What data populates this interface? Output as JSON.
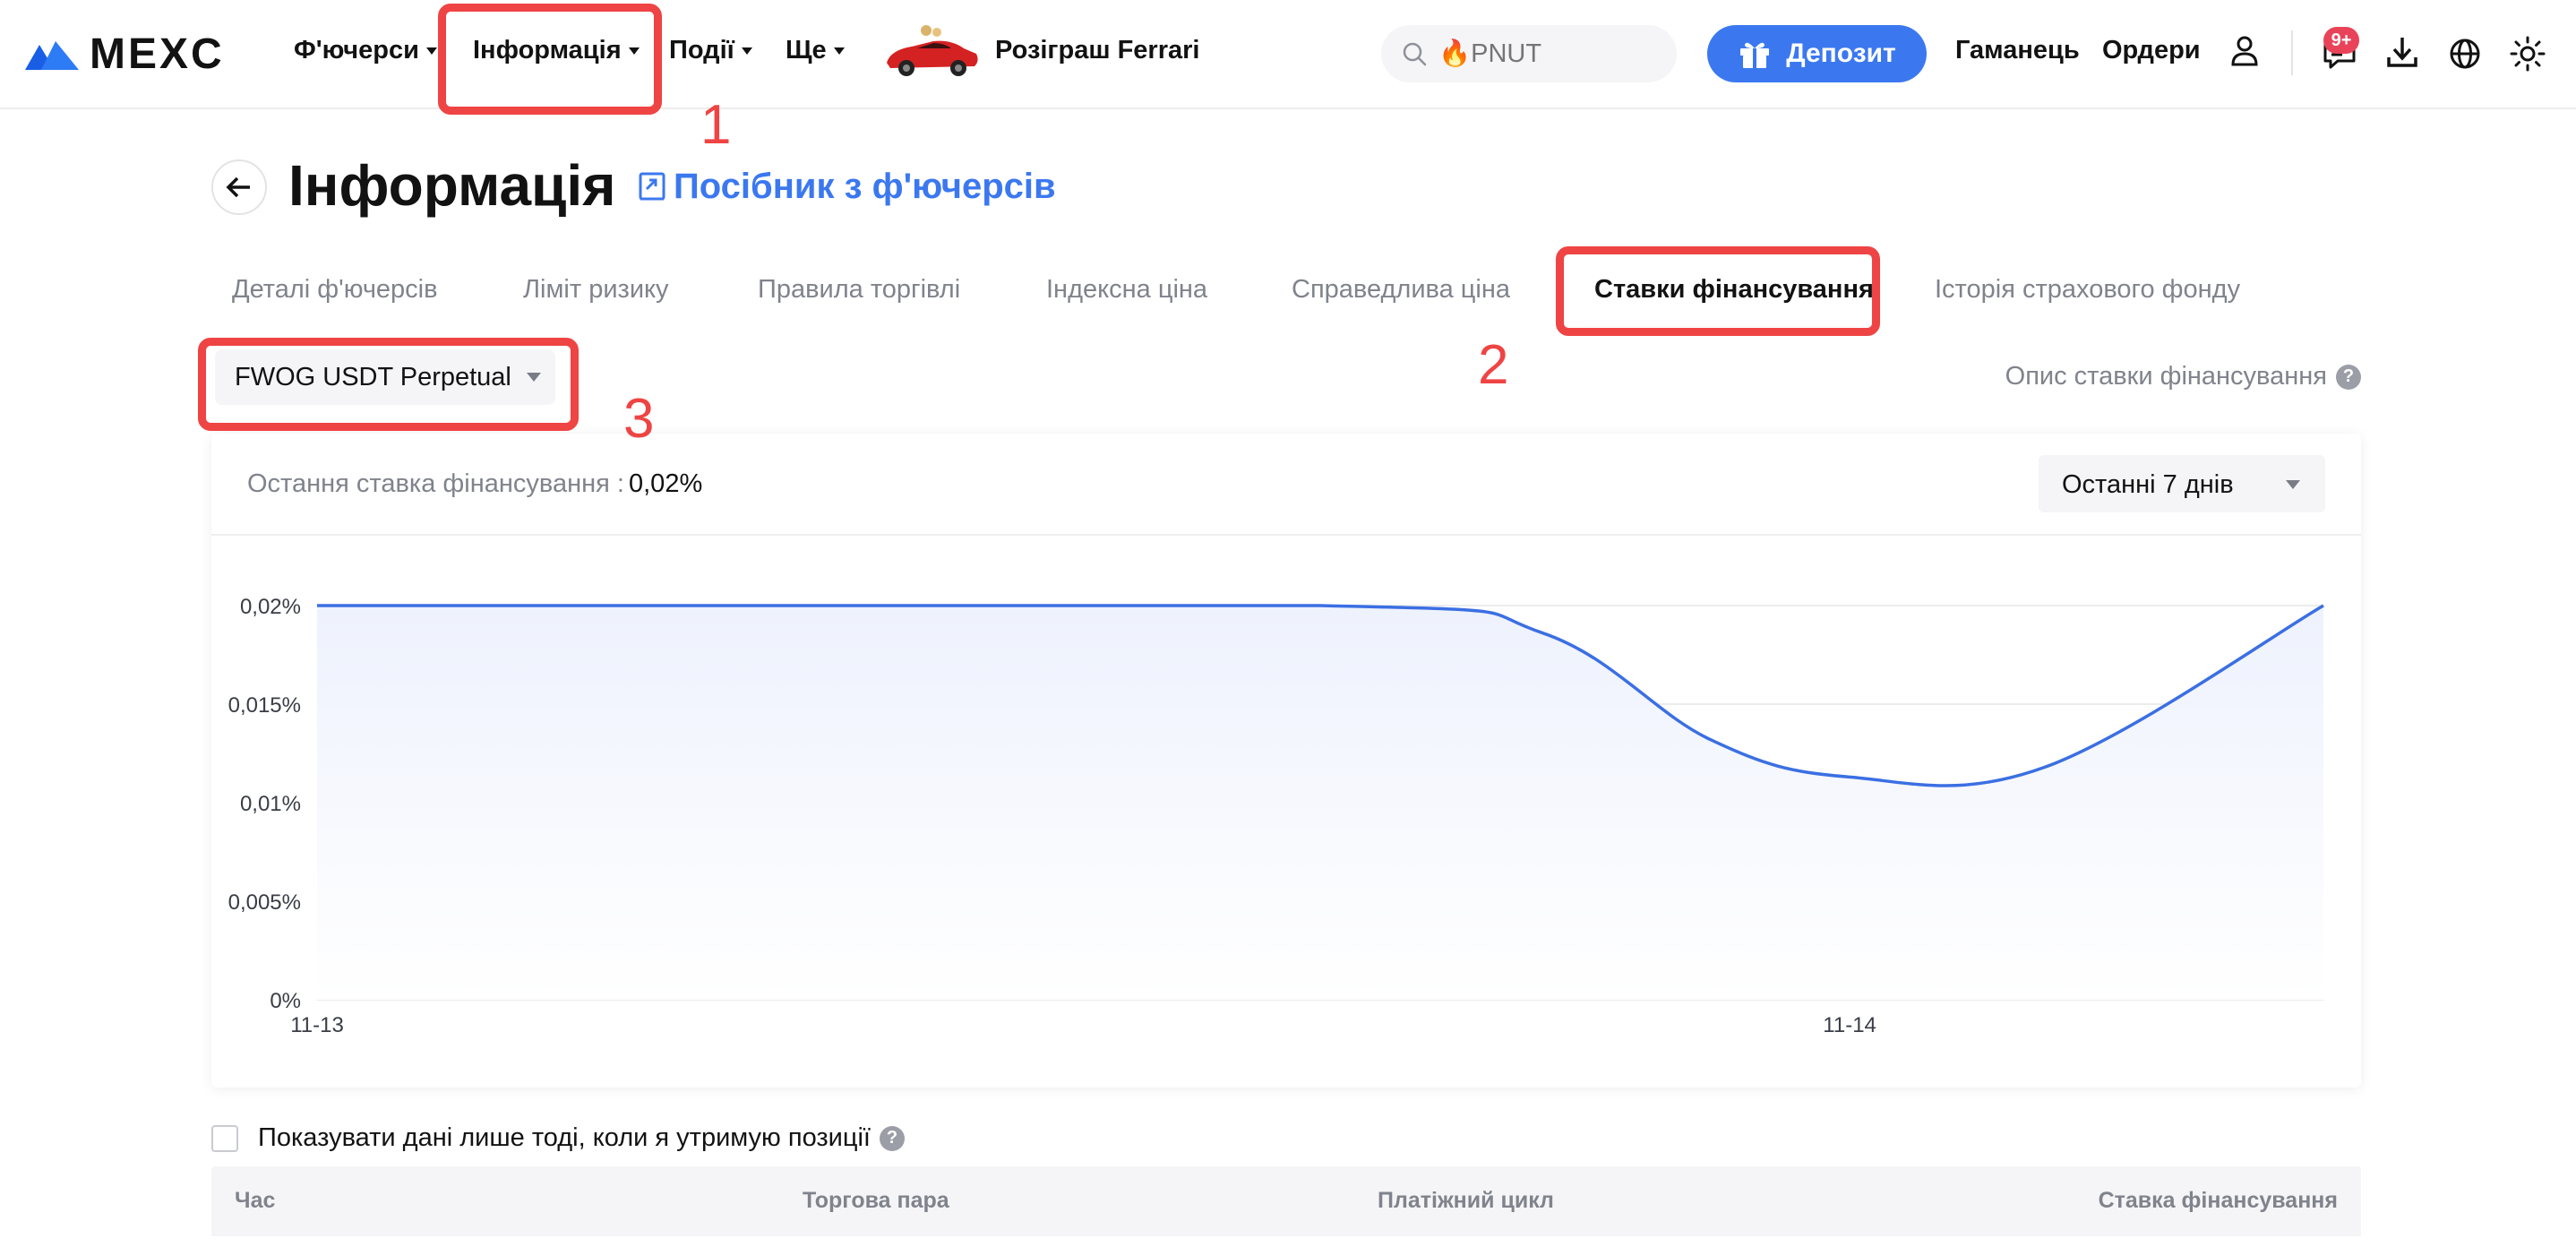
{
  "header": {
    "brand": "MEXC",
    "nav": [
      {
        "label": "Ф'ючерси"
      },
      {
        "label": "Інформація"
      },
      {
        "label": "Події"
      },
      {
        "label": "Ще"
      }
    ],
    "promo_label": "Розіграш Ferrari",
    "search_placeholder": "🔥PNUT",
    "deposit_label": "Депозит",
    "wallet_label": "Гаманець",
    "orders_label": "Ордери",
    "notification_badge": "9+"
  },
  "annotations": {
    "n1": "1",
    "n2": "2",
    "n3": "3"
  },
  "page": {
    "title": "Інформація",
    "guide_link": "Посібник з ф'ючерсів"
  },
  "tabs": [
    {
      "label": "Деталі ф'ючерсів"
    },
    {
      "label": "Ліміт ризику"
    },
    {
      "label": "Правила торгівлі"
    },
    {
      "label": "Індексна ціна"
    },
    {
      "label": "Справедлива ціна"
    },
    {
      "label": "Ставки фінансування",
      "active": true
    },
    {
      "label": "Історія страхового фонду"
    }
  ],
  "contract_select": {
    "selected": "FWOG USDT Perpetual"
  },
  "funding_description_link": "Опис ставки фінансування",
  "funding_card": {
    "last_rate_label": "Остання ставка фінансування :",
    "last_rate_value": "0,02%",
    "period_selected": "Останні 7 днів"
  },
  "chart_data": {
    "type": "area",
    "title": "",
    "xlabel": "",
    "ylabel": "",
    "y_tick_labels": [
      "0%",
      "0,005%",
      "0,01%",
      "0,015%",
      "0,02%"
    ],
    "y_ticks": [
      0,
      0.005,
      0.01,
      0.015,
      0.02
    ],
    "ylim": [
      0,
      0.02
    ],
    "x_tick_labels": [
      "11-13",
      "11-14"
    ],
    "x_ticks": [
      0,
      2.75
    ],
    "series": [
      {
        "x": [
          0,
          1.8,
          2.2,
          2.5,
          2.75,
          3.1,
          3.6
        ],
        "values": [
          0.02,
          0.02,
          0.0186,
          0.0132,
          0.0113,
          0.0118,
          0.02
        ]
      }
    ],
    "colors": {
      "line": "#3b6fe3",
      "fill": "#eef2fd",
      "grid": "#ececec"
    },
    "grid": true,
    "legend": "none"
  },
  "filter": {
    "only_positions_label": "Показувати дані лише тоді, коли я утримую позиції"
  },
  "table": {
    "columns": [
      "Час",
      "Торгова пара",
      "Платіжний цикл",
      "Ставка фінансування"
    ]
  }
}
